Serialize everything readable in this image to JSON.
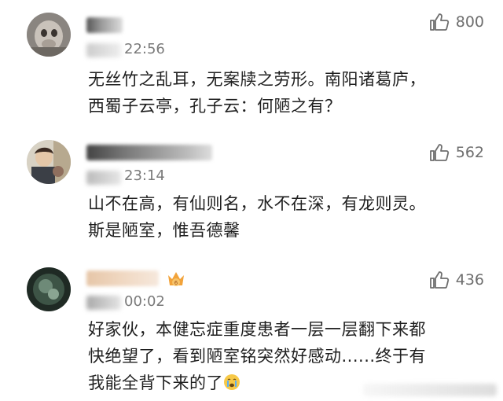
{
  "comments": [
    {
      "time": "22:56",
      "likes": "800",
      "lines": [
        "无丝竹之乱耳，无案牍之劳形。南阳诸葛庐，",
        "西蜀子云亭，孔子云：何陋之有？"
      ]
    },
    {
      "time": "23:14",
      "likes": "562",
      "lines": [
        "山不在高，有仙则名，水不在深，有龙则灵。",
        "斯是陋室，惟吾德馨"
      ]
    },
    {
      "time": "00:02",
      "likes": "436",
      "lines": [
        "好家伙，本健忘症重度患者一层一层翻下来都",
        "快绝望了，看到陋室铭突然好感动......终于有",
        "我能全背下来的了"
      ]
    }
  ],
  "icons": {
    "like": "thumbs-up-icon",
    "emoji": "crying-face-icon",
    "badge": "vip-crown-badge-icon"
  },
  "colors": {
    "text": "#1f1f1f",
    "meta": "#7a7a7a",
    "like": "#6e6e6e",
    "badge": "#f2a33a"
  }
}
